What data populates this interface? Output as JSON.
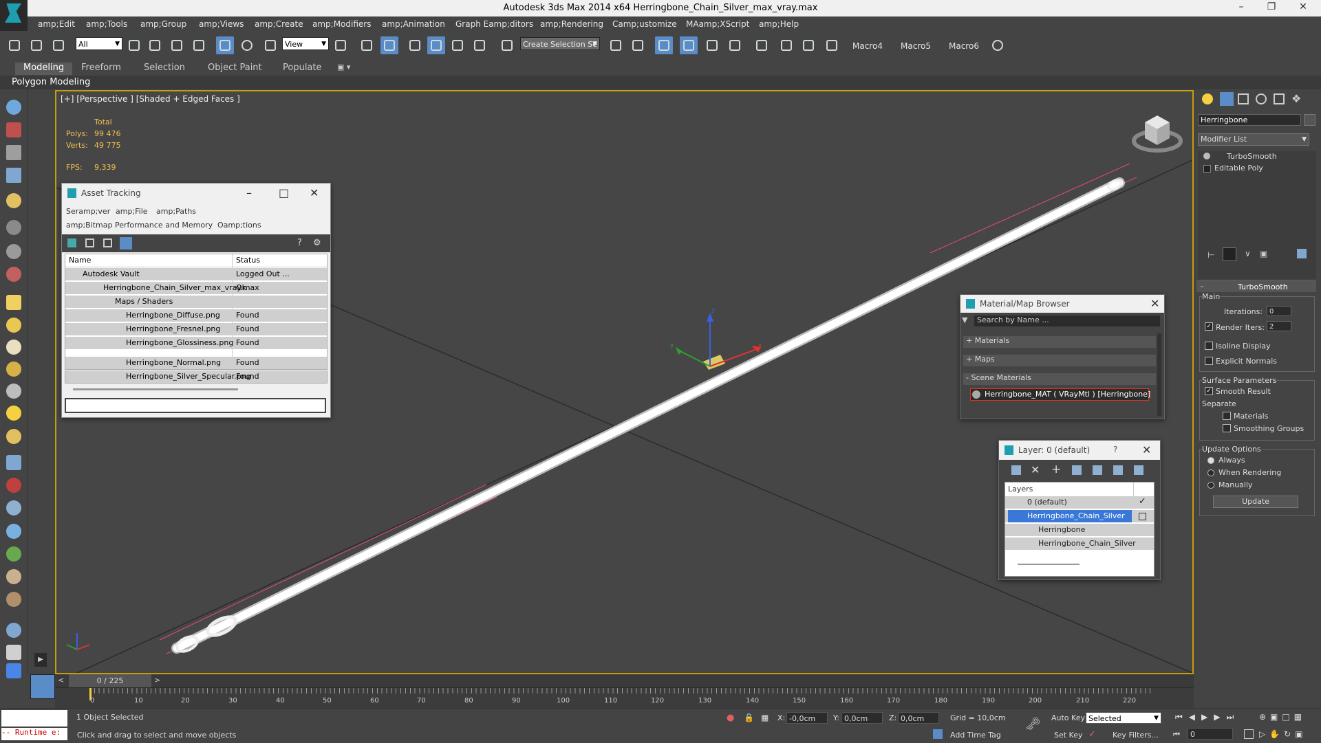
{
  "app": {
    "title": "Autodesk 3ds Max  2014 x64     Herringbone_Chain_Silver_max_vray.max"
  },
  "menu": [
    "amp;Edit",
    "amp;Tools",
    "amp;Group",
    "amp;Views",
    "amp;Create",
    "amp;Modifiers",
    "amp;Animation",
    "Graph Eamp;ditors",
    "amp;Rendering",
    "Camp;ustomize",
    "MAamp;XScript",
    "amp;Help"
  ],
  "toolbar": {
    "filter_value": "All",
    "refcoord_value": "View",
    "selection_set_placeholder": "Create Selection Se",
    "macros": [
      "Macro4",
      "Macro5",
      "Macro6"
    ]
  },
  "ribbon": {
    "tabs": [
      "Modeling",
      "Freeform",
      "Selection",
      "Object Paint",
      "Populate"
    ],
    "active_tab": "Modeling",
    "sub": "Polygon Modeling"
  },
  "viewport": {
    "label": "[+] [Perspective ] [Shaded + Edged Faces ]",
    "stats": {
      "total": "Total",
      "polys_label": "Polys:",
      "polys": "99 476",
      "verts_label": "Verts:",
      "verts": "49 775",
      "fps_label": "FPS:",
      "fps": "9,339"
    }
  },
  "asset_tracking": {
    "title": "Asset Tracking",
    "menu": [
      "Seramp;ver",
      "amp;File",
      "amp;Paths",
      "amp;Bitmap Performance and Memory",
      "Oamp;tions"
    ],
    "columns": [
      "Name",
      "Status"
    ],
    "rows": [
      {
        "name": "Autodesk Vault",
        "status": "Logged Out ..."
      },
      {
        "name": "Herringbone_Chain_Silver_max_vray.max",
        "status": "Ok"
      },
      {
        "name": "Maps / Shaders",
        "status": ""
      },
      {
        "name": "Herringbone_Diffuse.png",
        "status": "Found"
      },
      {
        "name": "Herringbone_Fresnel.png",
        "status": "Found"
      },
      {
        "name": "Herringbone_Glossiness.png",
        "status": "Found"
      },
      {
        "name": "Herringbone_Normal.png",
        "status": "Found"
      },
      {
        "name": "Herringbone_Silver_Specular.png",
        "status": "Found"
      }
    ]
  },
  "material_browser": {
    "title": "Material/Map Browser",
    "search_placeholder": "Search by Name ...",
    "sections": [
      "+ Materials",
      "+ Maps",
      "- Scene Materials"
    ],
    "scene_material": "Herringbone_MAT  ( VRayMtl ) [Herringbone]"
  },
  "layer_dialog": {
    "title": "Layer: 0 (default)",
    "help": "?",
    "header": "Layers",
    "items": [
      "0 (default)",
      "Herringbone_Chain_Silver",
      "Herringbone",
      "Herringbone_Chain_Silver"
    ]
  },
  "command_panel": {
    "object_name": "Herringbone",
    "modifier_list": "Modifier List",
    "stack": [
      "TurboSmooth",
      "Editable Poly"
    ],
    "rollout_title": "TurboSmooth",
    "main": "Main",
    "iterations_label": "Iterations:",
    "iterations": "0",
    "render_iters_label": "Render Iters:",
    "render_iters": "2",
    "isoline": "Isoline Display",
    "explicit_normals": "Explicit Normals",
    "surface_params": "Surface Parameters",
    "smooth_result": "Smooth Result",
    "separate": "Separate",
    "materials": "Materials",
    "smoothing_groups": "Smoothing Groups",
    "update_options": "Update Options",
    "always": "Always",
    "when_rendering": "When Rendering",
    "manually": "Manually",
    "update": "Update"
  },
  "timeline": {
    "frame": "0 / 225",
    "prev": "<",
    "next": ">",
    "ticks": [
      "0",
      "10",
      "20",
      "30",
      "40",
      "50",
      "60",
      "70",
      "80",
      "90",
      "100",
      "110",
      "120",
      "130",
      "140",
      "150",
      "160",
      "170",
      "180",
      "190",
      "200",
      "210",
      "220"
    ]
  },
  "status": {
    "maxscript": "-- Runtime e:",
    "selected": "1 Object Selected",
    "prompt": "Click and drag to select and move objects",
    "x_label": "X:",
    "x": "-0,0cm",
    "y_label": "Y:",
    "y": "0,0cm",
    "z_label": "Z:",
    "z": "0,0cm",
    "grid": "Grid = 10,0cm",
    "add_time_tag": "Add Time Tag",
    "auto_key": "Auto Key",
    "set_key": "Set Key",
    "key_mode": "Selected",
    "key_filters": "Key Filters...",
    "current_frame": "0"
  }
}
